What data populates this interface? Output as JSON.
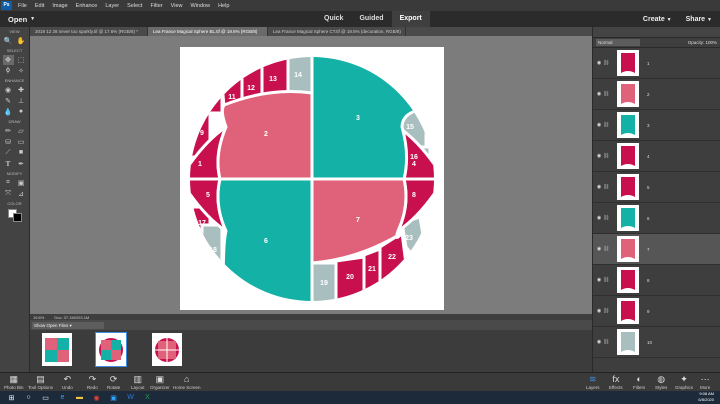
{
  "menu": {
    "logo": "Ps",
    "items": [
      "File",
      "Edit",
      "Image",
      "Enhance",
      "Layer",
      "Select",
      "Filter",
      "View",
      "Window",
      "Help"
    ]
  },
  "appbar": {
    "open_label": "Open",
    "modes": [
      "Quick",
      "Guided",
      "Export"
    ],
    "create_label": "Create",
    "share_label": "Share"
  },
  "tabs": [
    "2019 12 28 never too sparkly.tif @ 17.6% (RGB/8) *",
    "Lea France Magical Sphere BL.tif @ 19.6% (RGB/8)",
    "Lea France Magical Sphere CT.tif @ 19.6% (decoration, RGB/8)"
  ],
  "toolbox": {
    "sections": [
      "VIEW",
      "SELECT",
      "ENHANCE",
      "DRAW",
      "MODIFY",
      "COLOR"
    ]
  },
  "canvas": {
    "pieces": [
      {
        "n": "1",
        "color": "#c8104f"
      },
      {
        "n": "2",
        "color": "#e0627a"
      },
      {
        "n": "3",
        "color": "#13b1a6"
      },
      {
        "n": "4",
        "color": "#c8104f"
      },
      {
        "n": "5",
        "color": "#c8104f"
      },
      {
        "n": "6",
        "color": "#13b1a6"
      },
      {
        "n": "7",
        "color": "#e0627a"
      },
      {
        "n": "8",
        "color": "#c8104f"
      },
      {
        "n": "9",
        "color": "#c8104f"
      },
      {
        "n": "10",
        "color": "#c8104f"
      },
      {
        "n": "11",
        "color": "#c8104f"
      },
      {
        "n": "12",
        "color": "#c8104f"
      },
      {
        "n": "13",
        "color": "#c8104f"
      },
      {
        "n": "14",
        "color": "#a9bfbf"
      },
      {
        "n": "15",
        "color": "#a9bfbf"
      },
      {
        "n": "16",
        "color": "#a9bfbf"
      },
      {
        "n": "17",
        "color": "#c8104f"
      },
      {
        "n": "18",
        "color": "#a9bfbf"
      },
      {
        "n": "19",
        "color": "#a9bfbf"
      },
      {
        "n": "20",
        "color": "#c8104f"
      },
      {
        "n": "21",
        "color": "#c8104f"
      },
      {
        "n": "22",
        "color": "#c8104f"
      },
      {
        "n": "23",
        "color": "#a9bfbf"
      }
    ]
  },
  "status": {
    "zoom": "19.6%",
    "doc": "Doc: 37.1M/203.1M"
  },
  "bin": {
    "dropdown": "Show Open Files"
  },
  "layers": {
    "blend_mode": "Normal",
    "opacity_label": "Opacity:",
    "opacity_value": "100%",
    "items": [
      {
        "name": "1",
        "color": "#c8104f"
      },
      {
        "name": "2",
        "color": "#e0627a"
      },
      {
        "name": "3",
        "color": "#13b1a6"
      },
      {
        "name": "4",
        "color": "#c8104f"
      },
      {
        "name": "5",
        "color": "#c8104f"
      },
      {
        "name": "6",
        "color": "#13b1a6"
      },
      {
        "name": "7",
        "color": "#e0627a"
      },
      {
        "name": "8",
        "color": "#c8104f"
      },
      {
        "name": "9",
        "color": "#c8104f"
      },
      {
        "name": "10",
        "color": "#a9bfbf"
      }
    ]
  },
  "bottom": {
    "left": [
      "Photo Bin",
      "Tool Options",
      "Undo",
      "Redo",
      "Rotate",
      "Layout",
      "Organizer",
      "Home Screen"
    ],
    "right": [
      "Layers",
      "Effects",
      "Filters",
      "Styles",
      "Graphics",
      "More"
    ]
  },
  "clock": {
    "time": "9:08 AM",
    "date": "6/8/2020"
  },
  "colors": {
    "magenta": "#c8104f",
    "pink": "#e0627a",
    "teal": "#13b1a6",
    "grey": "#a9bfbf",
    "accent": "#3d8ee0"
  }
}
